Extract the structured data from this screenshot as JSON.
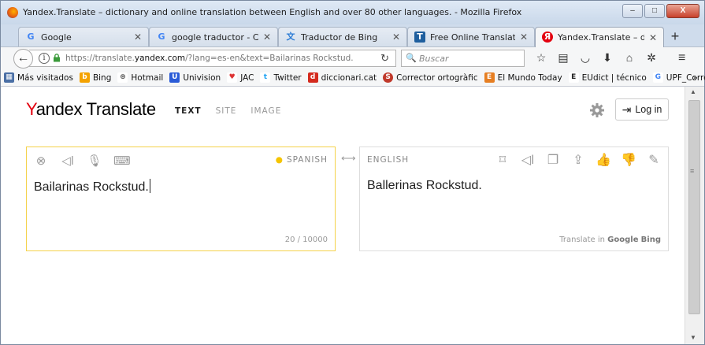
{
  "window": {
    "title": "Yandex.Translate – dictionary and online translation between English and over 80 other languages. - Mozilla Firefox",
    "buttons": {
      "minimize": "–",
      "maximize": "□",
      "close": "X"
    }
  },
  "tabs": [
    {
      "label": "Google",
      "icon": "google-favicon",
      "icon_text": "G",
      "icon_color": "#4285f4"
    },
    {
      "label": "google traductor - Cerca a",
      "icon": "google-favicon",
      "icon_text": "G",
      "icon_color": "#4285f4"
    },
    {
      "label": "Traductor de Bing",
      "icon": "bing-translator-favicon",
      "icon_text": "文",
      "icon_color": "#2c7cd5"
    },
    {
      "label": "Free Online Translations O",
      "icon": "translations-favicon",
      "icon_text": "T",
      "icon_color": "#1f5f9e"
    },
    {
      "label": "Yandex.Translate – diction",
      "icon": "yandex-favicon",
      "icon_text": "Я",
      "icon_color": "#e3000f",
      "active": true
    }
  ],
  "newtab_label": "+",
  "navbar": {
    "url_prefix": "https://translate.",
    "url_domain": "yandex.com",
    "url_suffix": "/?lang=es-en&text=Bailarinas Rockstud.",
    "search_placeholder": "Buscar"
  },
  "bookmarks": [
    {
      "label": "Más visitados",
      "icon": "most-visited-icon",
      "color": "#4a6fa5"
    },
    {
      "label": "Bing",
      "icon": "bing-icon",
      "color": "#f4a200",
      "text": "b"
    },
    {
      "label": "Hotmail",
      "icon": "hotmail-icon",
      "color": "#555555",
      "text": "⊛"
    },
    {
      "label": "Univision",
      "icon": "univision-icon",
      "color": "#2a5bd7",
      "text": "U"
    },
    {
      "label": "JAC",
      "icon": "jac-icon",
      "color": "#d33",
      "text": "♥"
    },
    {
      "label": "Twitter",
      "icon": "twitter-icon",
      "color": "#1da1f2",
      "text": "t"
    },
    {
      "label": "diccionari.cat",
      "icon": "diccionari-icon",
      "color": "#d42a1e",
      "text": "d"
    },
    {
      "label": "Corrector ortogràfic",
      "icon": "corrector-icon",
      "color": "#c0392b",
      "text": "S"
    },
    {
      "label": "El Mundo Today",
      "icon": "elmundotoday-icon",
      "color": "#e67e22",
      "text": "E"
    },
    {
      "label": "EUdict | técnico",
      "icon": "eudict-icon",
      "color": "#222222",
      "text": "E"
    },
    {
      "label": "UPF_Correo",
      "icon": "google-icon",
      "color": "#4285f4",
      "text": "G"
    }
  ],
  "bookmarks_more": "»",
  "header": {
    "logo_y": "Y",
    "logo_rest": "andex Translate",
    "modes": [
      "TEXT",
      "SITE",
      "IMAGE"
    ],
    "active_mode": "TEXT",
    "login_label": "Log in"
  },
  "source": {
    "language": "SPANISH",
    "text": "Bailarinas Rockstud.",
    "counter": "20 / 10000"
  },
  "target": {
    "language": "ENGLISH",
    "text": "Ballerinas Rockstud.",
    "translate_in_prefix": "Translate in",
    "translate_in_google": "Google",
    "translate_in_bing": "Bing"
  },
  "swap_label": "⟷"
}
